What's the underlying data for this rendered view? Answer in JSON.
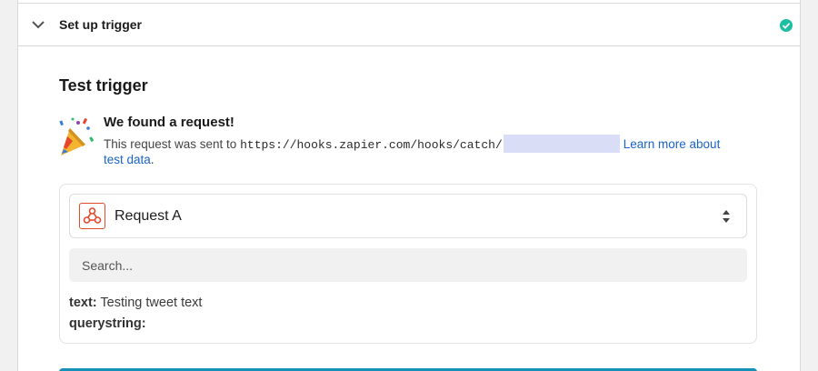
{
  "step": {
    "title": "Set up trigger",
    "status": "complete",
    "check_color": "#1dbfa3"
  },
  "test": {
    "section_title": "Test trigger",
    "found_title": "We found a request!",
    "sent_prefix": "This request was sent to",
    "url": "https://hooks.zapier.com/hooks/catch/",
    "link_text_1": "Learn more about",
    "link_text_2": "test data",
    "suffix": ".",
    "icon": "party-popper-icon"
  },
  "request": {
    "selected": "Request A",
    "app_icon": "webhook-icon",
    "accent_color": "#e34b2d"
  },
  "search": {
    "placeholder": "Search..."
  },
  "fields": [
    {
      "key": "text:",
      "value": "Testing tweet text"
    },
    {
      "key": "querystring:",
      "value": ""
    }
  ],
  "colors": {
    "link": "#1a63c7",
    "redaction": "#d9def6",
    "button": "#1790b8"
  }
}
